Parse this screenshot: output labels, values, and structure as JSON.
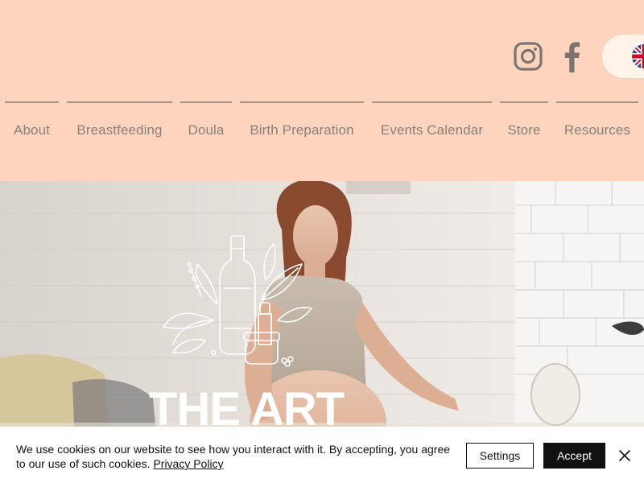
{
  "header": {
    "social": [
      {
        "icon": "instagram-icon"
      },
      {
        "icon": "facebook-icon"
      }
    ],
    "language": {
      "icon": "uk-flag-icon"
    }
  },
  "nav": {
    "items": [
      {
        "label": "About"
      },
      {
        "label": "Breastfeeding"
      },
      {
        "label": "Doula"
      },
      {
        "label": "Birth Preparation"
      },
      {
        "label": "Events Calendar"
      },
      {
        "label": "Store"
      },
      {
        "label": "Resources"
      }
    ]
  },
  "hero": {
    "title": "THE ART",
    "logo_icon": "bottle-leaves-icon"
  },
  "cookie": {
    "message": "We use cookies on our website to see how you interact with it. By accepting, you agree to our use of such cookies.",
    "link_label": "Privacy Policy",
    "settings_label": "Settings",
    "accept_label": "Accept",
    "close_icon": "close-icon"
  },
  "colors": {
    "header_bg": "#fdd5bf",
    "nav_text": "#8a7f7a",
    "accent_dark": "#111111"
  }
}
